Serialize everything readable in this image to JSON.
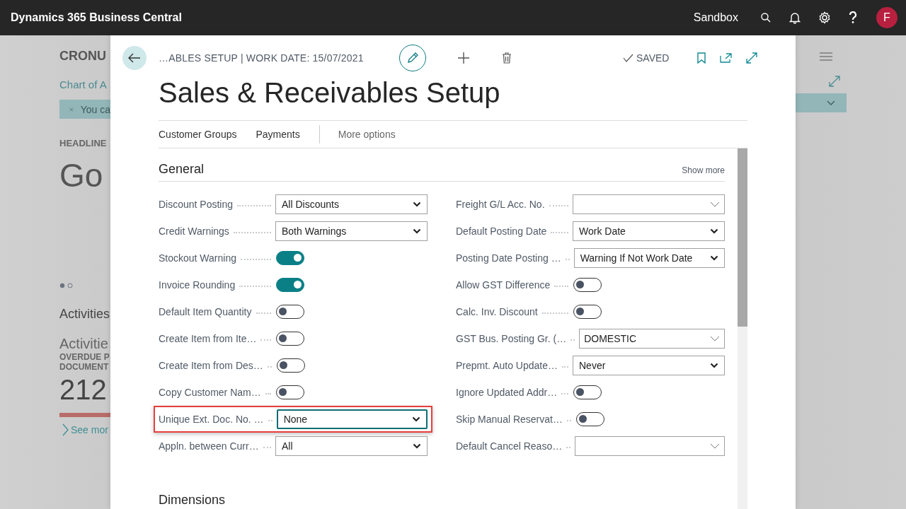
{
  "top_bar": {
    "app_name": "Dynamics 365 Business Central",
    "environment": "Sandbox",
    "avatar_initial": "F"
  },
  "background_page": {
    "company": "CRONU",
    "link": "Chart of A",
    "banner": "You ca",
    "headline_label": "HEADLINE",
    "headline": "Go",
    "section_title": "Activities",
    "cue_group": "Activitie",
    "cue_label_lines": [
      "OVERDUE P",
      "DOCUMENT"
    ],
    "cue_value": "212",
    "see_more": "See mor"
  },
  "dialog": {
    "breadcrumb": "…ABLES SETUP | WORK DATE: 15/07/2021",
    "status": "SAVED",
    "title": "Sales & Receivables Setup",
    "actions": [
      "Customer Groups",
      "Payments"
    ],
    "more_actions": "More options",
    "section": {
      "title": "General",
      "show_more": "Show more",
      "columns": [
        [
          {
            "label": "Discount Posting",
            "kind": "select",
            "value": "All Discounts",
            "highlighted": false
          },
          {
            "label": "Credit Warnings",
            "kind": "select",
            "value": "Both Warnings",
            "highlighted": false
          },
          {
            "label": "Stockout Warning",
            "kind": "toggle",
            "on": true,
            "highlighted": false
          },
          {
            "label": "Invoice Rounding",
            "kind": "toggle",
            "on": true,
            "highlighted": false
          },
          {
            "label": "Default Item Quantity",
            "kind": "toggle",
            "on": false,
            "highlighted": false
          },
          {
            "label": "Create Item from Ite…",
            "kind": "toggle",
            "on": false,
            "highlighted": false
          },
          {
            "label": "Create Item from Des…",
            "kind": "toggle",
            "on": false,
            "highlighted": false
          },
          {
            "label": "Copy Customer Nam…",
            "kind": "toggle",
            "on": false,
            "highlighted": false
          },
          {
            "label": "Unique Ext. Doc. No. …",
            "kind": "select",
            "value": "None",
            "highlighted": true
          },
          {
            "label": "Appln. between Curr…",
            "kind": "select",
            "value": "All",
            "highlighted": false
          }
        ],
        [
          {
            "label": "Freight G/L Acc. No.",
            "kind": "lookup",
            "highlighted": false
          },
          {
            "label": "Default Posting Date",
            "kind": "select",
            "value": "Work Date",
            "highlighted": false
          },
          {
            "label": "Posting Date Posting …",
            "kind": "select",
            "value": "Warning If Not Work Date",
            "highlighted": false
          },
          {
            "label": "Allow GST Difference",
            "kind": "toggle",
            "on": false,
            "highlighted": false
          },
          {
            "label": "Calc. Inv. Discount",
            "kind": "toggle",
            "on": false,
            "highlighted": false
          },
          {
            "label": "GST Bus. Posting Gr. (…",
            "kind": "lookup",
            "value": "DOMESTIC",
            "highlighted": false
          },
          {
            "label": "Prepmt. Auto Update…",
            "kind": "select",
            "value": "Never",
            "highlighted": false
          },
          {
            "label": "Ignore Updated Addr…",
            "kind": "toggle",
            "on": false,
            "highlighted": false
          },
          {
            "label": "Skip Manual Reservat…",
            "kind": "toggle",
            "on": false,
            "highlighted": false
          },
          {
            "label": "Default Cancel Reaso…",
            "kind": "lookup",
            "highlighted": false
          }
        ]
      ]
    },
    "next_section": "Dimensions"
  }
}
